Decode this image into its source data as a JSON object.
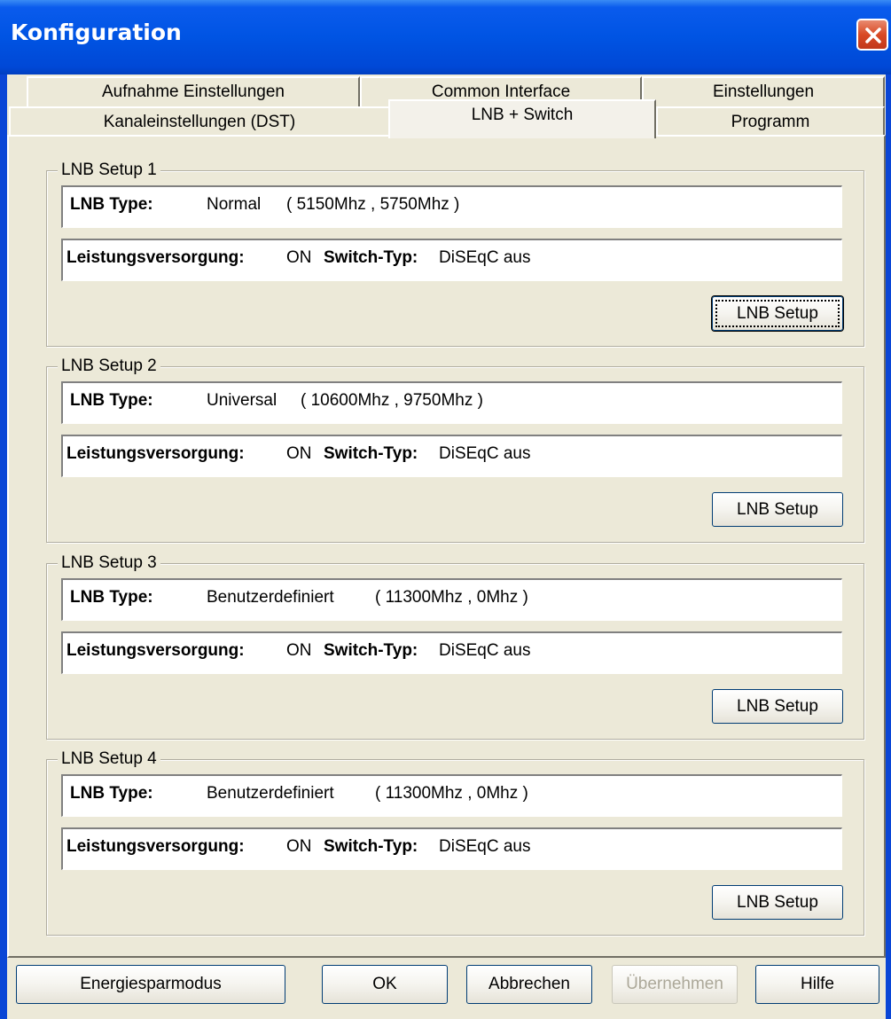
{
  "window": {
    "title": "Konfiguration"
  },
  "tabs_row1": [
    "Aufnahme Einstellungen",
    "Common Interface",
    "Einstellungen"
  ],
  "tabs_row2": [
    "Kanaleinstellungen  (DST)",
    "LNB + Switch",
    "Programm"
  ],
  "lnb_setups": [
    {
      "legend": "LNB Setup 1",
      "type_label": "LNB Type:",
      "type_value": "Normal",
      "freqs": "( 5150Mhz ,    5750Mhz )",
      "power_label": "Leistungsversorgung:",
      "power_value": "ON",
      "switch_label": "Switch-Typ:",
      "switch_value": "DiSEqC aus",
      "button": "LNB Setup"
    },
    {
      "legend": "LNB Setup 2",
      "type_label": "LNB Type:",
      "type_value": "Universal",
      "freqs": "( 10600Mhz ,    9750Mhz )",
      "power_label": "Leistungsversorgung:",
      "power_value": "ON",
      "switch_label": "Switch-Typ:",
      "switch_value": "DiSEqC aus",
      "button": "LNB Setup"
    },
    {
      "legend": "LNB Setup 3",
      "type_label": "LNB Type:",
      "type_value": "Benutzerdefiniert",
      "freqs": "( 11300Mhz ,    0Mhz )",
      "power_label": "Leistungsversorgung:",
      "power_value": "ON",
      "switch_label": "Switch-Typ:",
      "switch_value": "DiSEqC aus",
      "button": "LNB Setup"
    },
    {
      "legend": "LNB Setup 4",
      "type_label": "LNB Type:",
      "type_value": "Benutzerdefiniert",
      "freqs": "( 11300Mhz ,    0Mhz )",
      "power_label": "Leistungsversorgung:",
      "power_value": "ON",
      "switch_label": "Switch-Typ:",
      "switch_value": "DiSEqC aus",
      "button": "LNB Setup"
    }
  ],
  "footer": {
    "energy": "Energiesparmodus",
    "ok": "OK",
    "cancel": "Abbrechen",
    "apply": "Übernehmen",
    "help": "Hilfe"
  },
  "icons": {
    "close": "close-icon"
  },
  "colors": {
    "titlebar": "#0054e3",
    "close": "#d94a25",
    "face": "#ece9d8"
  }
}
